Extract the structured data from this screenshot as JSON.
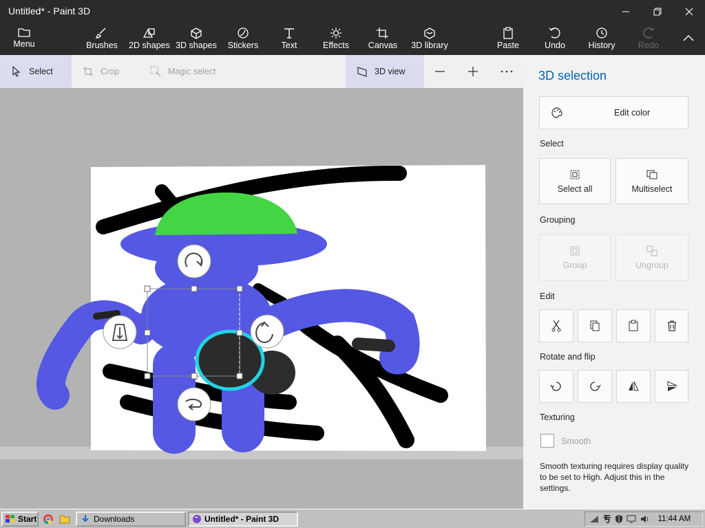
{
  "window": {
    "title": "Untitled* - Paint 3D"
  },
  "ribbon": {
    "menu": "Menu",
    "brushes": "Brushes",
    "shapes2d": "2D shapes",
    "shapes3d": "3D shapes",
    "stickers": "Stickers",
    "text": "Text",
    "effects": "Effects",
    "canvas": "Canvas",
    "library3d": "3D library",
    "paste": "Paste",
    "undo": "Undo",
    "history": "History",
    "redo": "Redo"
  },
  "toolbar": {
    "select": "Select",
    "crop": "Crop",
    "magic_select": "Magic select",
    "view3d": "3D view"
  },
  "panel": {
    "title": "3D selection",
    "edit_color": "Edit color",
    "select_section": "Select",
    "select_all": "Select all",
    "multiselect": "Multiselect",
    "grouping_section": "Grouping",
    "group": "Group",
    "ungroup": "Ungroup",
    "edit_section": "Edit",
    "rotate_section": "Rotate and flip",
    "texturing_section": "Texturing",
    "smooth": "Smooth",
    "smooth_checked": false,
    "note": "Smooth texturing requires display quality to be set to High. Adjust this in the settings."
  },
  "taskbar": {
    "start": "Start",
    "downloads": "Downloads",
    "paint": "Untitled* - Paint 3D",
    "clock": "11:44 AM"
  },
  "colors": {
    "chrome": "#2b2b2b",
    "accent": "#0063b1",
    "figure_blue": "#5558e3",
    "hat_green": "#44d544",
    "selection_ring": "#22d3e6"
  }
}
